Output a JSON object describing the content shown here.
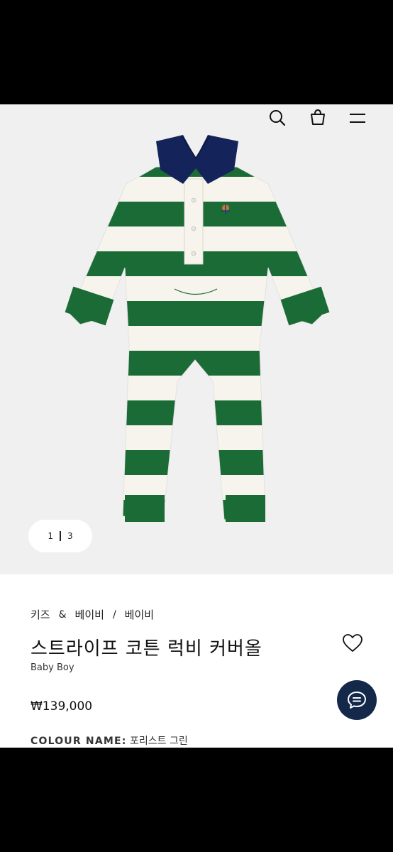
{
  "header": {
    "icons": [
      "search-icon",
      "shopping-bag-icon",
      "menu-icon"
    ]
  },
  "gallery": {
    "current": "1",
    "total": "3",
    "colors": {
      "green": "#1a6b35",
      "cream": "#f6f4ec",
      "navy": "#14245a"
    }
  },
  "product": {
    "breadcrumb": [
      "키즈",
      "&",
      "베이비",
      "/",
      "베이비"
    ],
    "title": "스트라이프 코튼 럭비 커버올",
    "subtitle": "Baby Boy",
    "price": "₩139,000",
    "colour_label": "COLOUR NAME:",
    "colour_value": "포리스트 그린"
  },
  "actions": {
    "wishlist_icon": "heart-icon",
    "chat_icon": "chat-icon",
    "chat_color": "#14284a"
  }
}
